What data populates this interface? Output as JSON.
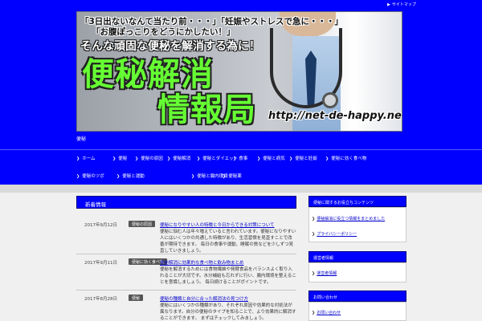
{
  "header": {
    "sitemap_label": "サイトマップ",
    "site_tagline": "便秘"
  },
  "banner": {
    "line1": "「3日出ないなんて当たり前・・・」「妊娠やストレスで急に・・・」",
    "line2": "「お腹ぽっこりをどうにかしたい！」",
    "line3": "そんな頑固な便秘を解消する為に！",
    "title_line1": "便秘解消",
    "title_line2": "情報局",
    "url": "http://net-de-happy.net/"
  },
  "nav": {
    "items": [
      {
        "label": "ホーム"
      },
      {
        "label": "便秘"
      },
      {
        "label": "便秘の原因"
      },
      {
        "label": "便秘解消"
      },
      {
        "label": "便秘とダイエット"
      },
      {
        "label": "食事"
      },
      {
        "label": "便秘と病気"
      },
      {
        "label": "便秘と妊娠"
      },
      {
        "label": "便秘に効く食べ物"
      },
      {
        "label": "便秘のツボ"
      },
      {
        "label": "便秘と運動"
      },
      {
        "label": "便秘と腸内環境"
      },
      {
        "label": "便秘薬"
      }
    ]
  },
  "main": {
    "section_title": "新着情報",
    "entries": [
      {
        "date": "2017年9月12日",
        "category": "便秘の原因",
        "title": "便秘になりやすい人の特徴と今日からできる対策について",
        "text": "便秘に悩む人は年々増えていると言われています。便秘になりやすい人にはいくつかの共通した特徴があり、生活習慣を見直すことで改善が期待できます。 毎日の食事や運動、睡眠の質などを少しずつ見直していきましょう。"
      },
      {
        "date": "2017年9月11日",
        "category": "便秘に効く食べ物",
        "title": "便秘解消に効果的な食べ物と飲み物まとめ",
        "text": "便秘を解消するためには食物繊維や発酵食品をバランスよく取り入れることが大切です。水分補給も忘れずに行い、腸内環境を整えることを意識しましょう。 毎日続けることがポイントです。"
      },
      {
        "date": "2017年8月28日",
        "category": "便秘",
        "title": "便秘の種類と自分に合った解消法の見つけ方",
        "text": "便秘にはいくつかの種類があり、それぞれ原因や効果的な対処法が異なります。自分の便秘のタイプを知ることで、より効果的に解消することができます。 まずはチェックしてみましょう。"
      }
    ]
  },
  "sidebar": {
    "sections": [
      {
        "heading": "便秘に関するお役立ちコンテンツ",
        "links": [
          "便秘解消に役立つ情報をまとめました"
        ]
      },
      {
        "heading": "運営者情報",
        "links": [
          "運営者情報"
        ]
      },
      {
        "heading": "お問い合わせ",
        "links": [
          "お問い合わせ"
        ]
      }
    ],
    "extra_links": [
      "プライバシーポリシー"
    ]
  }
}
